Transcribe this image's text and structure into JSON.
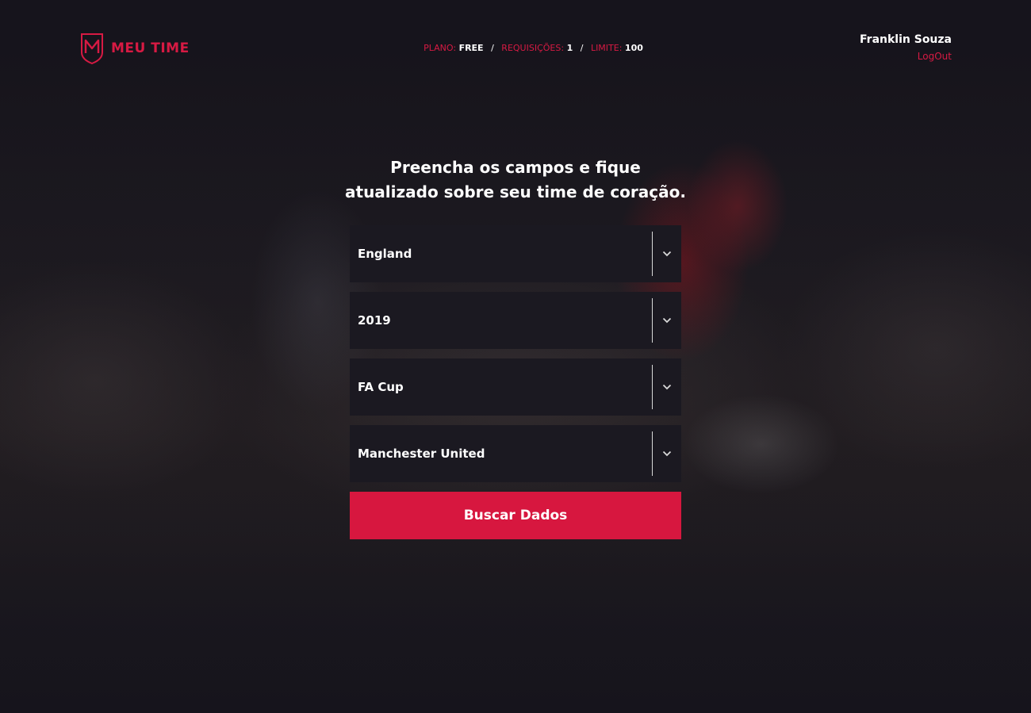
{
  "brand": {
    "name": "MEU TIME",
    "accent_color": "#d71a43",
    "logo_icon": "shield-m-icon"
  },
  "plan_bar": {
    "plan_label": "PLANO:",
    "plan_value": "FREE",
    "requests_label": "REQUISIÇÕES:",
    "requests_value": "1",
    "limit_label": "LIMITE:",
    "limit_value": "100",
    "separator": "/"
  },
  "user": {
    "name": "Franklin Souza",
    "logout_label": "LogOut"
  },
  "form": {
    "headline_line1": "Preencha os campos e fique",
    "headline_line2": "atualizado sobre seu time de coração.",
    "country": "England",
    "season": "2019",
    "league": "FA Cup",
    "team": "Manchester United",
    "caret_icon": "chevron-down-icon",
    "submit_label": "Buscar Dados"
  }
}
